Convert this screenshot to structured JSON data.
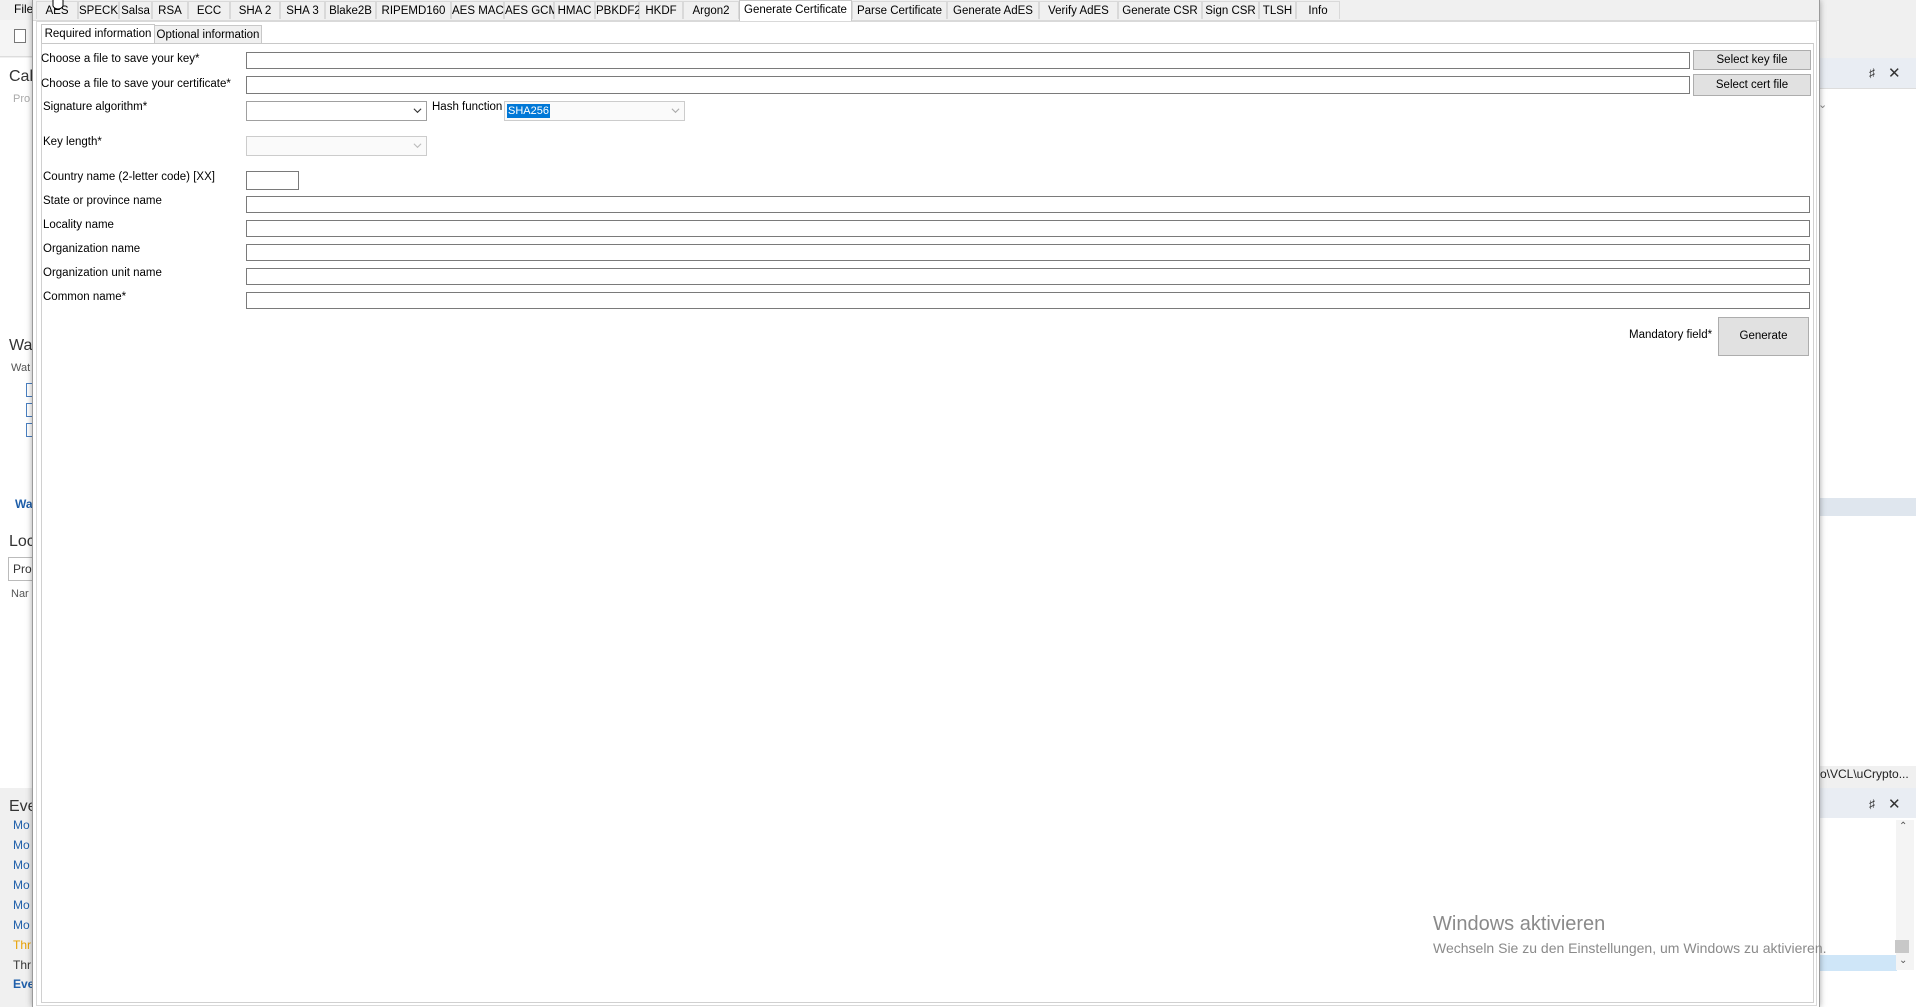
{
  "background_ide": {
    "menu_file": "File",
    "left_fragments": [
      "Cal",
      "Pro",
      "Wa",
      "Wat",
      "Wa",
      "Loc",
      "Pro",
      "Nar",
      "Eve",
      "Mo",
      "Mo",
      "Mo",
      "Mo",
      "Mo",
      "Mo",
      "Thr",
      "Thr",
      "Eve"
    ],
    "path_text": "o\\VCL\\uCrypto...",
    "pin_icon": "pin-icon",
    "close_icon": "close-icon"
  },
  "tabs": [
    "AES",
    "SPECK",
    "Salsa",
    "RSA",
    "ECC",
    "SHA 2",
    "SHA 3",
    "Blake2B",
    "RIPEMD160",
    "AES MAC",
    "AES GCM",
    "HMAC",
    "PBKDF2",
    "HKDF",
    "Argon2",
    "Generate Certificate",
    "Parse Certificate",
    "Generate AdES",
    "Verify AdES",
    "Generate CSR",
    "Sign CSR",
    "TLSH",
    "Info"
  ],
  "active_tab": "Generate Certificate",
  "subtabs": {
    "required": "Required information",
    "optional": "Optional information"
  },
  "form": {
    "key_file_label": "Choose a file to save your key*",
    "key_file_value": "",
    "select_key_button": "Select key file",
    "cert_file_label": "Choose a file to save your certificate*",
    "cert_file_value": "",
    "select_cert_button": "Select cert file",
    "sig_alg_label": "Signature algorithm*",
    "sig_alg_value": "",
    "hash_label": "Hash function",
    "hash_value": "SHA256",
    "key_length_label": "Key length*",
    "key_length_value": "",
    "country_label": "Country name (2-letter code) [XX]",
    "country_value": "",
    "state_label": "State or province name",
    "state_value": "",
    "locality_label": "Locality name",
    "locality_value": "",
    "org_label": "Organization name",
    "org_value": "",
    "org_unit_label": "Organization unit name",
    "org_unit_value": "",
    "common_label": "Common name*",
    "common_value": "",
    "mandatory_note": "Mandatory field*",
    "generate_button": "Generate"
  },
  "watermark": {
    "title": "Windows aktivieren",
    "subtitle": "Wechseln Sie zu den Einstellungen, um Windows zu aktivieren."
  },
  "colors": {
    "selection": "#0078d7",
    "link_blue": "#1f5faa",
    "warning_orange": "#e8a000"
  }
}
